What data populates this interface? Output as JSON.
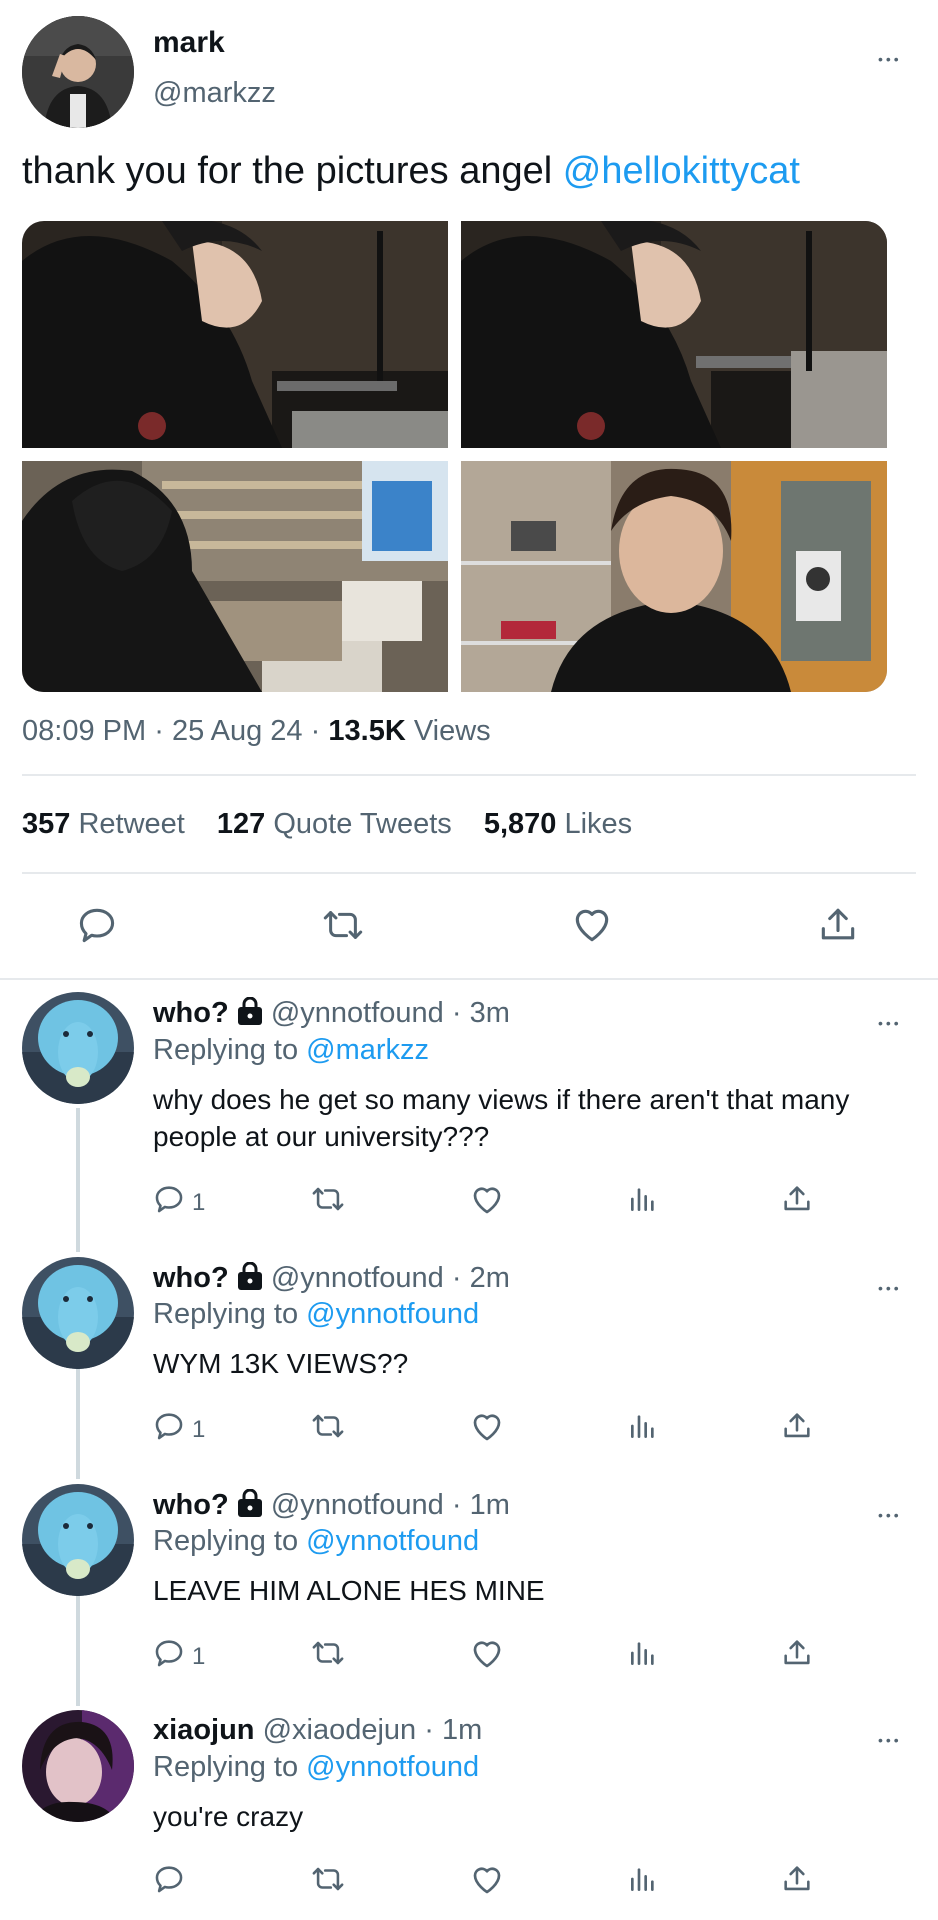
{
  "tweet": {
    "author_name": "mark",
    "author_handle": "@markzz",
    "text": "thank you for the pictures angel ",
    "mention": "@hellokittycat",
    "time": "08:09 PM",
    "date": "25 Aug 24",
    "views_count": "13.5K",
    "views_label": "Views",
    "retweets_count": "357",
    "retweets_label": "Retweet",
    "quotes_count": "127",
    "quotes_label": "Quote Tweets",
    "likes_count": "5,870",
    "likes_label": "Likes",
    "separator": "·"
  },
  "replies": [
    {
      "name": "who?",
      "handle": "@ynnotfound",
      "time": "3m",
      "replying_prefix": "Replying to ",
      "replying_to": "@markzz",
      "text": "why does he get so many views if there aren't that many people at our university???",
      "reply_count": "1"
    },
    {
      "name": "who?",
      "handle": "@ynnotfound",
      "time": "2m",
      "replying_prefix": "Replying to ",
      "replying_to": "@ynnotfound",
      "text": "WYM 13K VIEWS??",
      "reply_count": "1"
    },
    {
      "name": "who?",
      "handle": "@ynnotfound",
      "time": "1m",
      "replying_prefix": "Replying to ",
      "replying_to": "@ynnotfound",
      "text": "LEAVE HIM ALONE HES MINE",
      "reply_count": "1"
    },
    {
      "name": "xiaojun",
      "handle": "@xiaodejun",
      "time": "1m",
      "replying_prefix": "Replying to ",
      "replying_to": "@ynnotfound",
      "text": "you're crazy",
      "reply_count": ""
    }
  ],
  "icons": {
    "reply": "reply-icon",
    "retweet": "retweet-icon",
    "like": "heart-icon",
    "views": "views-icon",
    "share": "share-icon",
    "more": "more-icon",
    "lock": "lock-icon"
  },
  "colors": {
    "accent": "#1d9bf0",
    "text": "#0f1419",
    "secondary": "#536471",
    "divider": "#e6e9ec"
  }
}
